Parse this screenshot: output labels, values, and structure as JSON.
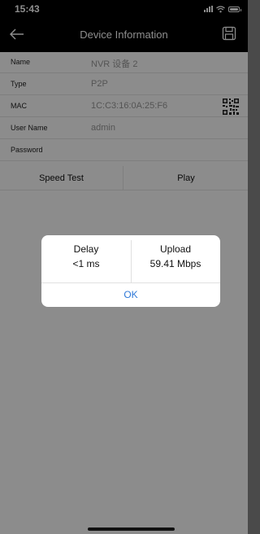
{
  "status_bar": {
    "time": "15:43"
  },
  "nav": {
    "back_icon": "arrow-left-icon",
    "title": "Device Information",
    "right_icon": "save-icon"
  },
  "device": {
    "rows": [
      {
        "label": "Name",
        "value": "NVR 设备 2"
      },
      {
        "label": "Type",
        "value": "P2P"
      },
      {
        "label": "MAC",
        "value": "1C:C3:16:0A:25:F6"
      },
      {
        "label": "User Name",
        "value": "admin"
      },
      {
        "label": "Password",
        "value": ""
      }
    ],
    "qr_icon": "qr-code-icon"
  },
  "actions": {
    "speed_test": "Speed Test",
    "play": "Play"
  },
  "dialog": {
    "delay_label": "Delay",
    "delay_value": "<1 ms",
    "upload_label": "Upload",
    "upload_value": "59.41 Mbps",
    "ok_label": "OK"
  },
  "colors": {
    "nav_bg": "#000000",
    "link": "#2f79d8",
    "overlay": "rgba(0,0,0,0.45)"
  }
}
